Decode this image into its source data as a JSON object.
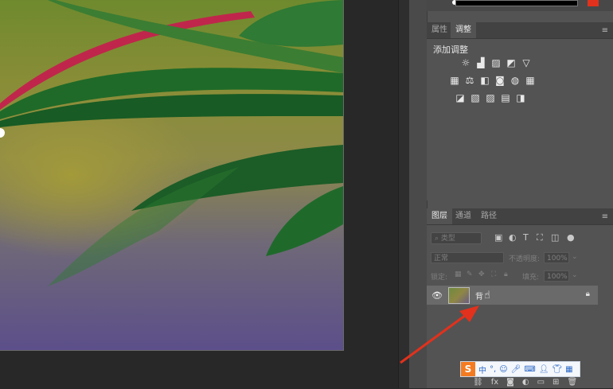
{
  "colors": {
    "panel_bg": "#535353",
    "canvas_bg": "#282828",
    "accent_red": "#e2311c",
    "ime_orange": "#f47b20"
  },
  "adjustments_panel": {
    "tabs": [
      "属性",
      "调整"
    ],
    "active_tab": "调整",
    "title": "添加调整",
    "icon_rows": [
      [
        "brightness-contrast-icon",
        "levels-icon",
        "curves-icon",
        "exposure-icon",
        "vibrance-icon"
      ],
      [
        "hue-saturation-icon",
        "color-balance-icon",
        "black-white-icon",
        "photo-filter-icon",
        "channel-mixer-icon",
        "color-lookup-icon"
      ],
      [
        "invert-icon",
        "posterize-icon",
        "threshold-icon",
        "gradient-map-icon",
        "selective-color-icon"
      ]
    ]
  },
  "layers_panel": {
    "tabs": [
      "图层",
      "通道",
      "路径"
    ],
    "active_tab": "图层",
    "search_placeholder": "类型",
    "blend_mode": "正常",
    "opacity_label": "不透明度:",
    "opacity_value": "100%",
    "lock_label": "锁定:",
    "fill_label": "填充:",
    "fill_value": "100%",
    "layer_name": "背"
  },
  "ime_toolbar": {
    "language": "中"
  }
}
